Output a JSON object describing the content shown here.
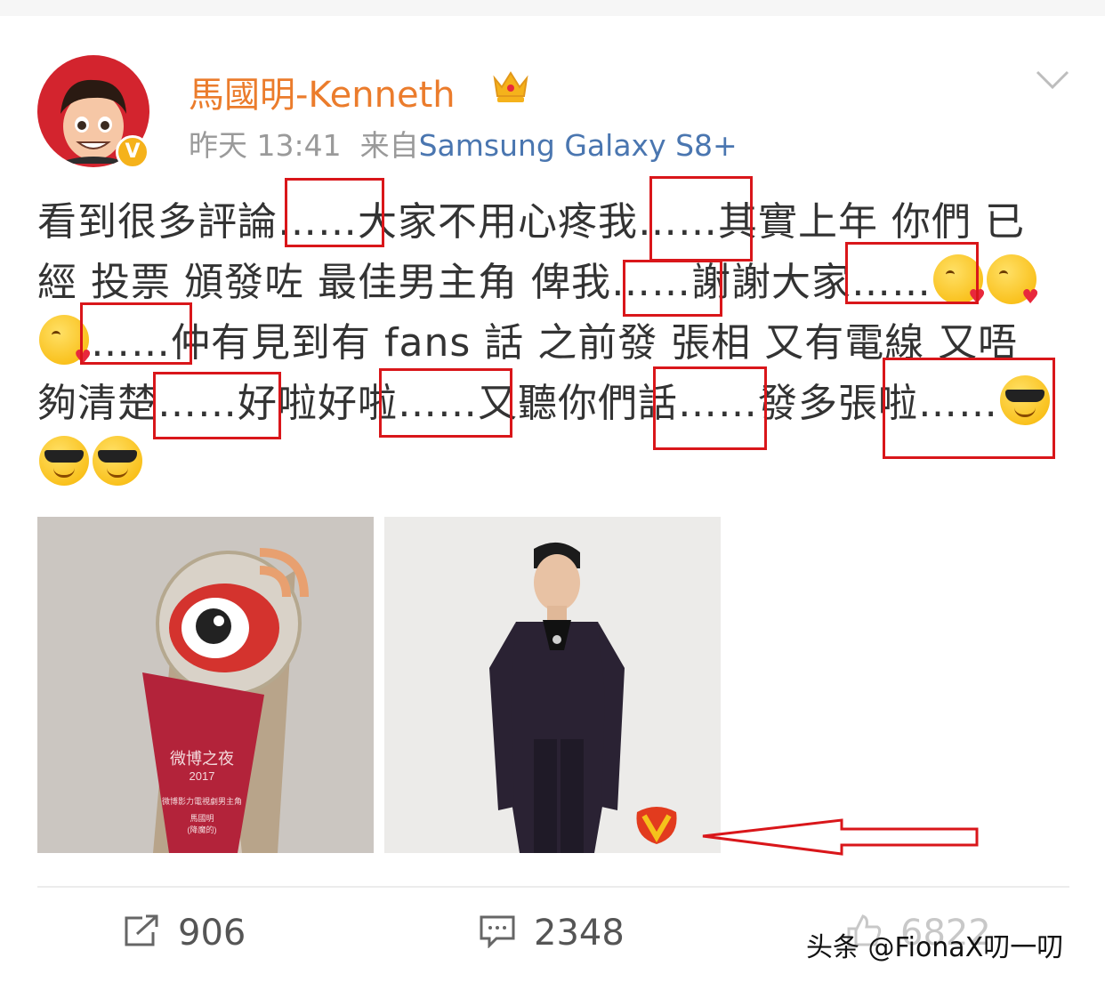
{
  "post": {
    "username": "馬國明-Kenneth",
    "time": "昨天 13:41",
    "source_prefix": "来自",
    "device": "Samsung Galaxy S8+",
    "text": {
      "line1": "看到很多評論……大家不用心疼我……其實上年 你們 已",
      "line2": "經 投票 頒發咗 最佳男主角 俾我……謝謝大家……",
      "line3": "……仲有見到有 fans 話 之前發 張相 又有電線 又唔",
      "line4": "夠清楚……好啦好啦……又聽你們話……發多張啦……"
    },
    "emoji_names": [
      "kiss-emoji",
      "cool-emoji"
    ],
    "images": [
      {
        "caption_title": "微博之夜",
        "caption_year": "2017",
        "caption_line1": "微博影力電視劇男主角",
        "caption_line2": "馬國明",
        "caption_line3": "(降魔的)"
      },
      {
        "icon": "weibo-v-logo"
      }
    ]
  },
  "actions": {
    "repost_count": "906",
    "comment_count": "2348",
    "like_count": "6822"
  },
  "watermark": "头条 @FionaX叨一叨",
  "colors": {
    "username": "#eb7c2c",
    "device_link": "#4a76b0",
    "annotation_red": "#d9161a",
    "verified_badge": "#f5b21b"
  }
}
